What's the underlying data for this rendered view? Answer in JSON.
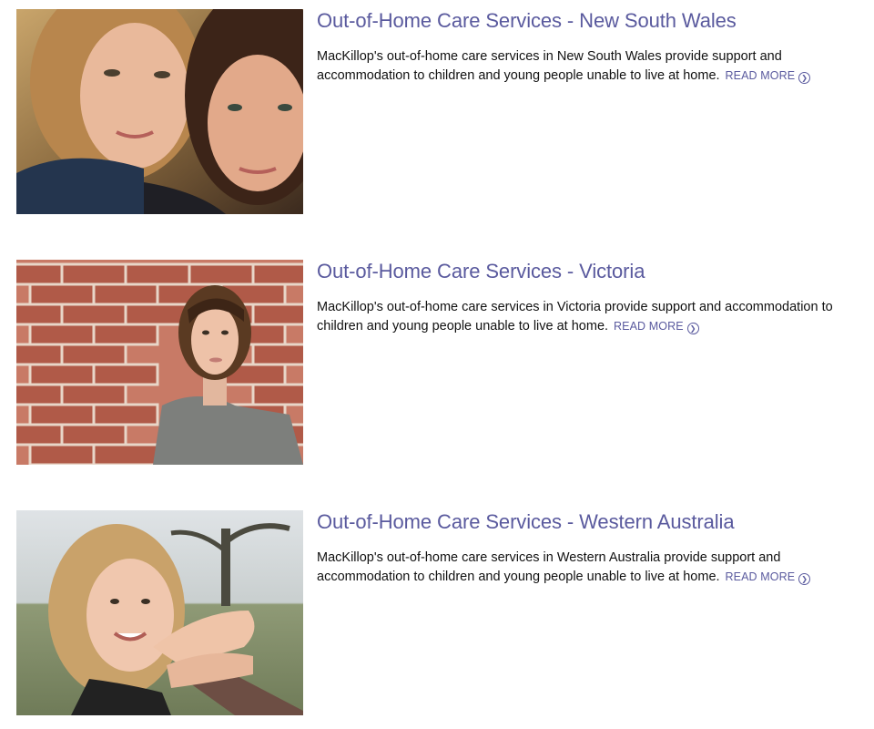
{
  "services": [
    {
      "title": "Out-of-Home Care Services - New South Wales",
      "description": "MacKillop's out-of-home care services in New South Wales provide support and accommodation to children and young people unable to live at home.",
      "read_more": "READ MORE"
    },
    {
      "title": "Out-of-Home Care Services - Victoria",
      "description": "MacKillop's out-of-home care services in Victoria provide support and accommodation to children and young people unable to live at home.",
      "read_more": "READ MORE"
    },
    {
      "title": "Out-of-Home Care Services - Western Australia",
      "description": "MacKillop's out-of-home care services in Western Australia provide support and accommodation to children and young people unable to live at home.",
      "read_more": "READ MORE"
    }
  ],
  "icons": {
    "read_more": "chevron-circle-right-icon"
  },
  "colors": {
    "link": "#5a5a9e",
    "text": "#111111",
    "background": "#ffffff"
  }
}
